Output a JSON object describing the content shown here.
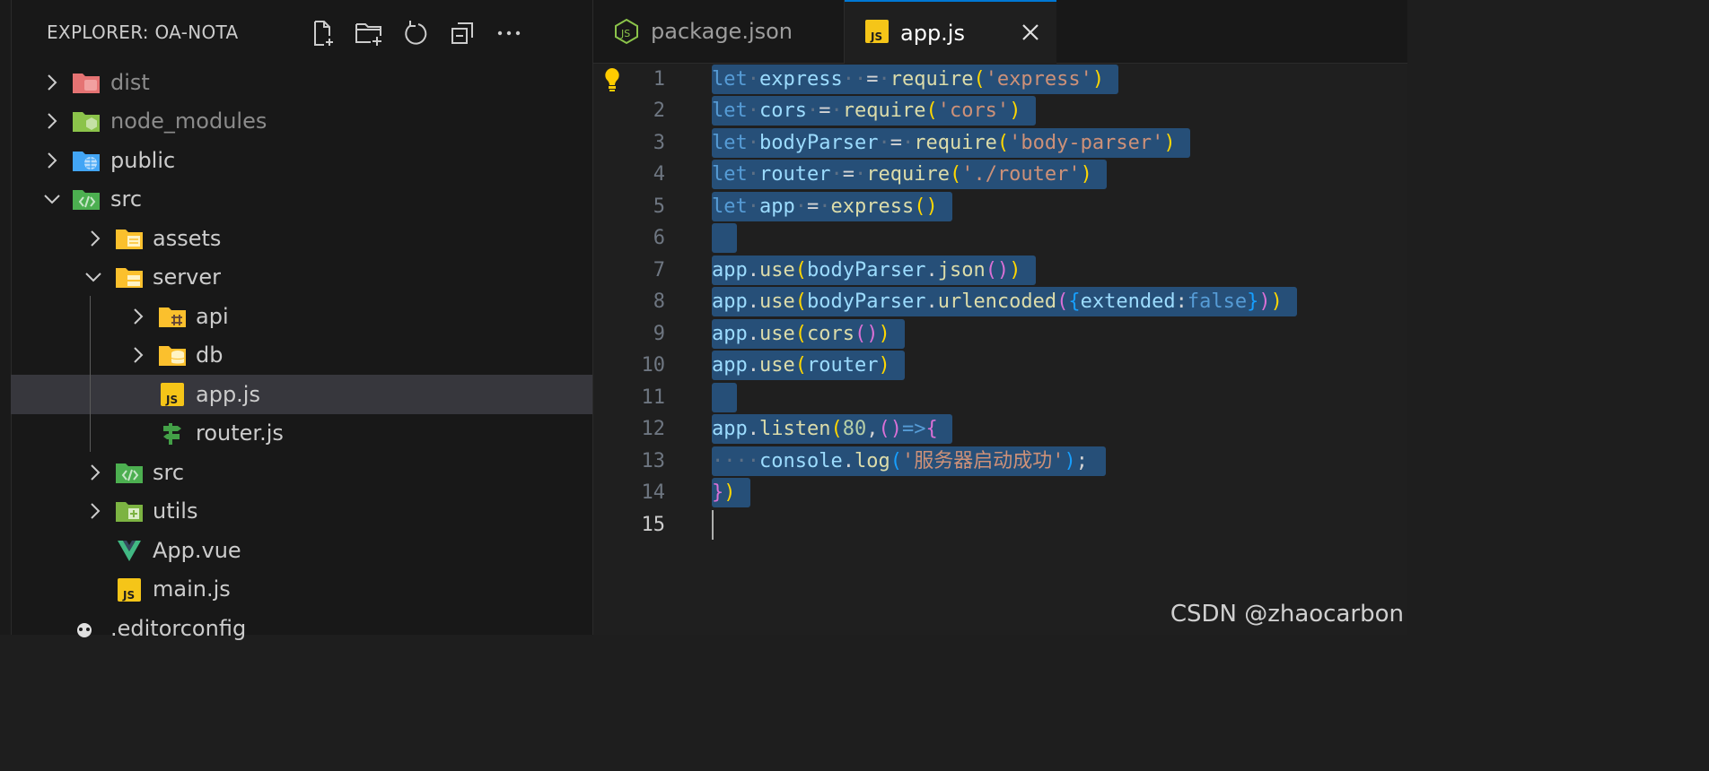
{
  "explorer": {
    "title": "EXPLORER: OA-NOTA",
    "actions": [
      "new-file-icon",
      "new-folder-icon",
      "refresh-icon",
      "collapse-all-icon",
      "more-icon"
    ],
    "items": [
      {
        "label": "dist"
      },
      {
        "label": "node_modules"
      },
      {
        "label": "public"
      },
      {
        "label": "src"
      },
      {
        "label": "assets"
      },
      {
        "label": "server"
      },
      {
        "label": "api"
      },
      {
        "label": "db"
      },
      {
        "label": "app.js"
      },
      {
        "label": "router.js"
      },
      {
        "label": "src"
      },
      {
        "label": "utils"
      },
      {
        "label": "App.vue"
      },
      {
        "label": "main.js"
      },
      {
        "label": ".editorconfig"
      }
    ]
  },
  "tabs": [
    {
      "label": "package.json",
      "icon": "nodejs-icon",
      "active": false
    },
    {
      "label": "app.js",
      "icon": "js-icon",
      "active": true
    }
  ],
  "editor": {
    "line_numbers": [
      "1",
      "2",
      "3",
      "4",
      "5",
      "6",
      "7",
      "8",
      "9",
      "10",
      "11",
      "12",
      "13",
      "14",
      "15"
    ],
    "lines": [
      [
        [
          "k",
          "let"
        ],
        [
          "ws",
          "·"
        ],
        [
          "v",
          "express"
        ],
        [
          "ws",
          "··"
        ],
        [
          "",
          "="
        ],
        [
          "ws",
          "·"
        ],
        [
          "f",
          "require"
        ],
        [
          "p1",
          "("
        ],
        [
          "s",
          "'express'"
        ],
        [
          "p1",
          ")"
        ]
      ],
      [
        [
          "k",
          "let"
        ],
        [
          "ws",
          "·"
        ],
        [
          "v",
          "cors"
        ],
        [
          "ws",
          "·"
        ],
        [
          "",
          "="
        ],
        [
          "ws",
          "·"
        ],
        [
          "f",
          "require"
        ],
        [
          "p1",
          "("
        ],
        [
          "s",
          "'cors'"
        ],
        [
          "p1",
          ")"
        ]
      ],
      [
        [
          "k",
          "let"
        ],
        [
          "ws",
          "·"
        ],
        [
          "v",
          "bodyParser"
        ],
        [
          "ws",
          "·"
        ],
        [
          "",
          "="
        ],
        [
          "ws",
          "·"
        ],
        [
          "f",
          "require"
        ],
        [
          "p1",
          "("
        ],
        [
          "s",
          "'body-parser'"
        ],
        [
          "p1",
          ")"
        ]
      ],
      [
        [
          "k",
          "let"
        ],
        [
          "ws",
          "·"
        ],
        [
          "v",
          "router"
        ],
        [
          "ws",
          "·"
        ],
        [
          "",
          "="
        ],
        [
          "ws",
          "·"
        ],
        [
          "f",
          "require"
        ],
        [
          "p1",
          "("
        ],
        [
          "s",
          "'./router'"
        ],
        [
          "p1",
          ")"
        ]
      ],
      [
        [
          "k",
          "let"
        ],
        [
          "ws",
          "·"
        ],
        [
          "v",
          "app"
        ],
        [
          "ws",
          "·"
        ],
        [
          "",
          "="
        ],
        [
          "ws",
          "·"
        ],
        [
          "f",
          "express"
        ],
        [
          "p1",
          "()"
        ]
      ],
      [],
      [
        [
          "v",
          "app"
        ],
        [
          "",
          "."
        ],
        [
          "f",
          "use"
        ],
        [
          "p1",
          "("
        ],
        [
          "v",
          "bodyParser"
        ],
        [
          "",
          "."
        ],
        [
          "f",
          "json"
        ],
        [
          "p2",
          "()"
        ],
        [
          "p1",
          ")"
        ]
      ],
      [
        [
          "v",
          "app"
        ],
        [
          "",
          "."
        ],
        [
          "f",
          "use"
        ],
        [
          "p1",
          "("
        ],
        [
          "v",
          "bodyParser"
        ],
        [
          "",
          "."
        ],
        [
          "f",
          "urlencoded"
        ],
        [
          "p2",
          "("
        ],
        [
          "p3",
          "{"
        ],
        [
          "v",
          "extended"
        ],
        [
          "",
          ":"
        ],
        [
          "k",
          "false"
        ],
        [
          "p3",
          "}"
        ],
        [
          "p2",
          ")"
        ],
        [
          "p1",
          ")"
        ]
      ],
      [
        [
          "v",
          "app"
        ],
        [
          "",
          "."
        ],
        [
          "f",
          "use"
        ],
        [
          "p1",
          "("
        ],
        [
          "f",
          "cors"
        ],
        [
          "p2",
          "()"
        ],
        [
          "p1",
          ")"
        ]
      ],
      [
        [
          "v",
          "app"
        ],
        [
          "",
          "."
        ],
        [
          "f",
          "use"
        ],
        [
          "p1",
          "("
        ],
        [
          "v",
          "router"
        ],
        [
          "p1",
          ")"
        ]
      ],
      [],
      [
        [
          "v",
          "app"
        ],
        [
          "",
          "."
        ],
        [
          "f",
          "listen"
        ],
        [
          "p1",
          "("
        ],
        [
          "n",
          "80"
        ],
        [
          "",
          ","
        ],
        [
          "p2",
          "()"
        ],
        [
          "k",
          "=>"
        ],
        [
          "p2",
          "{"
        ]
      ],
      [
        [
          "ws",
          "····"
        ],
        [
          "v",
          "console"
        ],
        [
          "",
          "."
        ],
        [
          "f",
          "log"
        ],
        [
          "p3",
          "("
        ],
        [
          "s",
          "'服务器启动成功'"
        ],
        [
          "p3",
          ")"
        ],
        [
          "",
          ";"
        ]
      ],
      [
        [
          "p2",
          "}"
        ],
        [
          "p1",
          ")"
        ]
      ],
      []
    ]
  },
  "watermark": "CSDN @zhaocarbon"
}
